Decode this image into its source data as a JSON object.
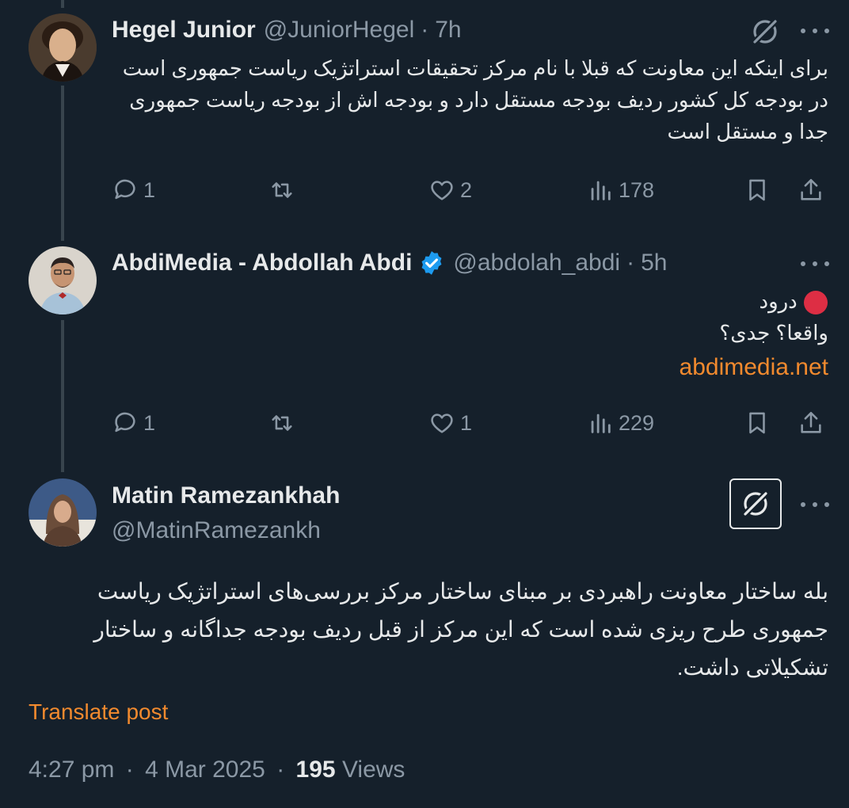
{
  "colors": {
    "background": "#15202b",
    "text": "#e7e9ea",
    "muted": "#8b98a5",
    "accent_link": "#f28a2e",
    "verified_blue": "#1d9bf0",
    "thread_line": "#38444d"
  },
  "tweets": [
    {
      "display_name": "Hegel Junior",
      "handle": "@JuniorHegel",
      "separator": "·",
      "time": "7h",
      "verified": false,
      "avatar_icon": "portrait-avatar",
      "body_lines": [
        "برای اینکه این معاونت که قبلا با نام مرکز تحقیقات استراتژیک ریاست جمهوری است",
        "در بودجه کل کشور ردیف بودجه مستقل دارد و بودجه اش از بودجه ریاست جمهوری",
        "جدا و مستقل است"
      ],
      "actions": {
        "replies": "1",
        "reposts": "",
        "likes": "2",
        "views": "178"
      }
    },
    {
      "display_name": "AbdiMedia - Abdollah Abdi",
      "handle": "@abdolah_abdi",
      "separator": "·",
      "time": "5h",
      "verified": true,
      "avatar_icon": "man-avatar",
      "body_lines": [
        "درود",
        "واقعا؟ جدی؟"
      ],
      "emoji": "red-circle-icon",
      "link": "abdimedia.net",
      "actions": {
        "replies": "1",
        "reposts": "",
        "likes": "1",
        "views": "229"
      }
    }
  ],
  "main_tweet": {
    "display_name": "Matin Ramezankhah",
    "handle": "@MatinRamezankh",
    "avatar_icon": "woman-avatar",
    "body_lines": [
      "بله ساختار معاونت راهبردی بر مبنای ساختار مرکز بررسی‌های استراتژیک ریاست",
      "جمهوری طرح ریزی شده است که این مرکز از قبل ردیف بودجه جداگانه و ساختار",
      "تشکیلاتی داشت."
    ],
    "translate_label": "Translate post",
    "time": "4:27 pm",
    "separator": "·",
    "date": "4 Mar 2025",
    "views_count": "195",
    "views_label": "Views"
  }
}
